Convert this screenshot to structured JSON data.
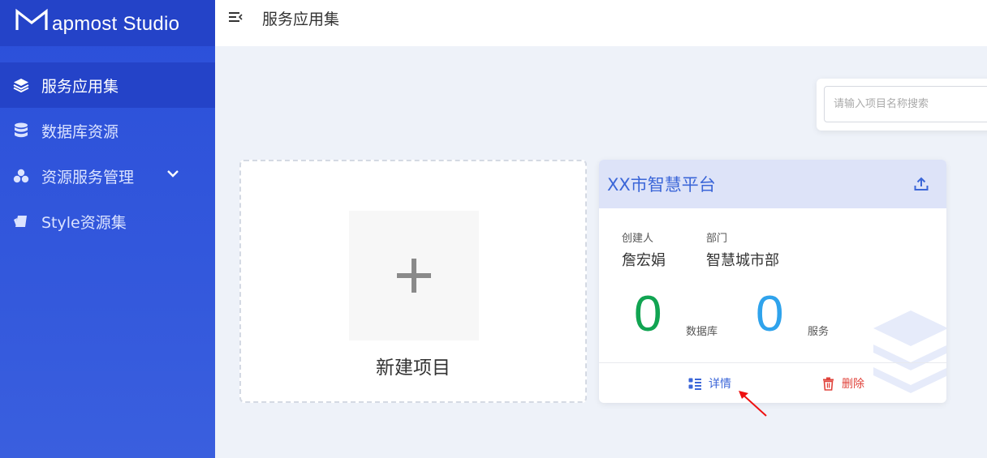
{
  "app": {
    "logo_text": "apmost Studio"
  },
  "sidebar": {
    "items": [
      {
        "label": "服务应用集",
        "icon": "layers-icon",
        "active": true
      },
      {
        "label": "数据库资源",
        "icon": "database-icon"
      },
      {
        "label": "资源服务管理",
        "icon": "cubes-icon",
        "expandable": true
      },
      {
        "label": "Style资源集",
        "icon": "style-icon"
      }
    ]
  },
  "header": {
    "title": "服务应用集"
  },
  "search": {
    "placeholder": "请输入项目名称搜索",
    "value": ""
  },
  "new_project": {
    "label": "新建项目"
  },
  "project": {
    "title": "XX市智慧平台",
    "creator_label": "创建人",
    "creator": "詹宏娟",
    "dept_label": "部门",
    "dept": "智慧城市部",
    "db_count": "0",
    "db_label": "数据库",
    "service_count": "0",
    "service_label": "服务",
    "details_label": "详情",
    "delete_label": "删除"
  },
  "colors": {
    "sidebar": "#2b4fd9",
    "accent": "#3b66d8",
    "db_count": "#11a452",
    "service_count": "#2fa3ec",
    "delete": "#e0433b"
  }
}
